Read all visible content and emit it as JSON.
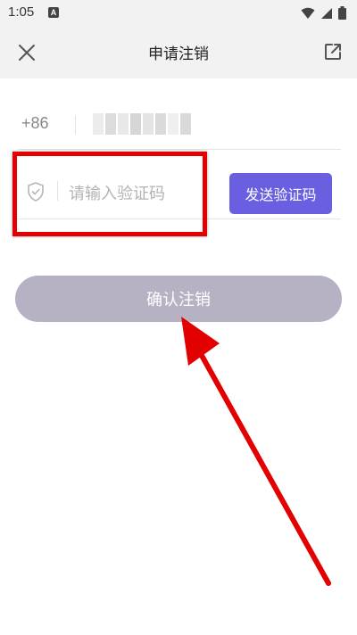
{
  "status_bar": {
    "time": "1:05",
    "app_badge": "A"
  },
  "app_bar": {
    "title": "申请注销",
    "close_icon": "close-icon",
    "share_icon": "external-link-icon"
  },
  "form": {
    "country_code": "+86",
    "phone_value_blurred": true,
    "code_placeholder": "请输入验证码",
    "send_code_label": "发送验证码",
    "confirm_label": "确认注销"
  },
  "colors": {
    "accent": "#6a5fe0",
    "confirm_disabled": "#b6b2c3",
    "annotation_red": "#e30000"
  }
}
